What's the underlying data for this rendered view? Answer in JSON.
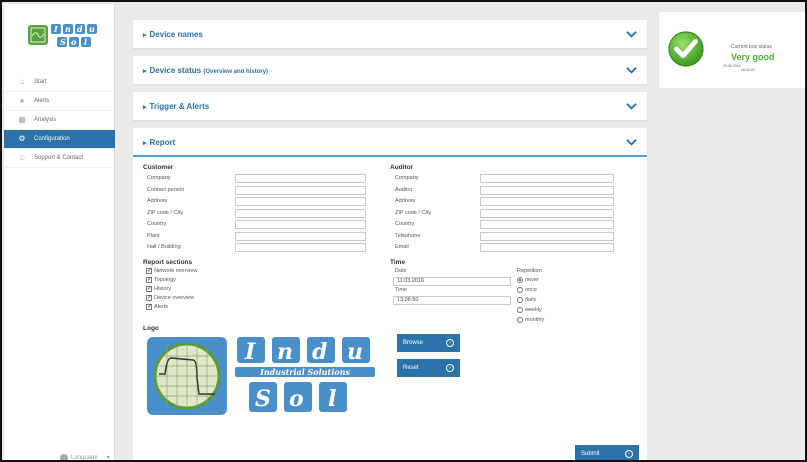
{
  "sidebar": {
    "items": [
      {
        "label": "Start",
        "icon": "home-icon"
      },
      {
        "label": "Alerts",
        "icon": "bell-icon"
      },
      {
        "label": "Analysis",
        "icon": "chart-icon"
      },
      {
        "label": "Configuration",
        "icon": "gears-icon",
        "active": true
      },
      {
        "label": "Support & Contact",
        "icon": "people-icon"
      }
    ],
    "language": "Language"
  },
  "panels": {
    "device_names": "Device names",
    "device_status": "Device status",
    "device_status_sub": "(Overview and history)",
    "trigger_alerts": "Trigger & Alerts",
    "report": "Report"
  },
  "report": {
    "customer": {
      "title": "Customer",
      "fields": [
        "Company",
        "Contact person",
        "Address",
        "ZIP code / City",
        "Country",
        "Plant",
        "Hall / Building"
      ]
    },
    "auditor": {
      "title": "Auditor",
      "fields": [
        "Company",
        "Auditor",
        "Address",
        "ZIP code / City",
        "Country",
        "Telephone",
        "Email"
      ]
    },
    "sections": {
      "title": "Report sections",
      "items": [
        "Network overview",
        "Topology",
        "History",
        "Device overview",
        "Alerts"
      ]
    },
    "time": {
      "title": "Time",
      "date_label": "Date",
      "date_value": "11.03.2016",
      "time_label": "Time",
      "time_value": "13:06:50",
      "repetition_label": "Repetition",
      "repetition_options": [
        "never",
        "once",
        "daily",
        "weekly",
        "monthly"
      ],
      "repetition_selected": "never"
    },
    "logo": {
      "title": "Logo",
      "letters_top": [
        "I",
        "n",
        "d",
        "u"
      ],
      "tagline": "Industrial Solutions",
      "letters_bottom": [
        "S",
        "o",
        "l"
      ]
    },
    "browse_label": "Browse",
    "reset_label": "Reset",
    "submit_label": "Submit"
  },
  "status": {
    "label": "Current bus status",
    "value": "Very good",
    "date": "29.06.2016",
    "time": "16:02:22"
  },
  "colors": {
    "accent": "#2a72a8",
    "highlight": "#4aa3d8",
    "good": "#4cae2d",
    "logo": "#4a8fc9"
  }
}
